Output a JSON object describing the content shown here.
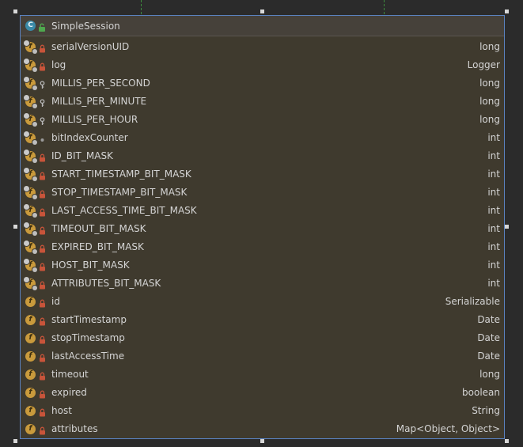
{
  "class": {
    "title": "SimpleSession",
    "kind_letter": "C",
    "kind_icon": "class-icon",
    "visibility_icon": "unlock-icon"
  },
  "fields": [
    {
      "name": "serialVersionUID",
      "type": "long",
      "visibility": "private",
      "static": true
    },
    {
      "name": "log",
      "type": "Logger",
      "visibility": "private",
      "static": true
    },
    {
      "name": "MILLIS_PER_SECOND",
      "type": "long",
      "visibility": "protected",
      "static": true
    },
    {
      "name": "MILLIS_PER_MINUTE",
      "type": "long",
      "visibility": "protected",
      "static": true
    },
    {
      "name": "MILLIS_PER_HOUR",
      "type": "long",
      "visibility": "protected",
      "static": true
    },
    {
      "name": "bitIndexCounter",
      "type": "int",
      "visibility": "package",
      "static": true
    },
    {
      "name": "ID_BIT_MASK",
      "type": "int",
      "visibility": "private",
      "static": true
    },
    {
      "name": "START_TIMESTAMP_BIT_MASK",
      "type": "int",
      "visibility": "private",
      "static": true
    },
    {
      "name": "STOP_TIMESTAMP_BIT_MASK",
      "type": "int",
      "visibility": "private",
      "static": true
    },
    {
      "name": "LAST_ACCESS_TIME_BIT_MASK",
      "type": "int",
      "visibility": "private",
      "static": true
    },
    {
      "name": "TIMEOUT_BIT_MASK",
      "type": "int",
      "visibility": "private",
      "static": true
    },
    {
      "name": "EXPIRED_BIT_MASK",
      "type": "int",
      "visibility": "private",
      "static": true
    },
    {
      "name": "HOST_BIT_MASK",
      "type": "int",
      "visibility": "private",
      "static": true
    },
    {
      "name": "ATTRIBUTES_BIT_MASK",
      "type": "int",
      "visibility": "private",
      "static": true
    },
    {
      "name": "id",
      "type": "Serializable",
      "visibility": "private",
      "static": false
    },
    {
      "name": "startTimestamp",
      "type": "Date",
      "visibility": "private",
      "static": false
    },
    {
      "name": "stopTimestamp",
      "type": "Date",
      "visibility": "private",
      "static": false
    },
    {
      "name": "lastAccessTime",
      "type": "Date",
      "visibility": "private",
      "static": false
    },
    {
      "name": "timeout",
      "type": "long",
      "visibility": "private",
      "static": false
    },
    {
      "name": "expired",
      "type": "boolean",
      "visibility": "private",
      "static": false
    },
    {
      "name": "host",
      "type": "String",
      "visibility": "private",
      "static": false
    },
    {
      "name": "attributes",
      "type": "Map<Object, Object>",
      "visibility": "private",
      "static": false
    }
  ],
  "field_icon_letter": "f",
  "colors": {
    "node_background": "#3f3a2e",
    "selection_border": "#5a82c0",
    "field_icon": "#c99a3c",
    "class_icon": "#3a8aa8",
    "private_lock": "#c8543a",
    "protected_key": "#b8b8b8",
    "package_dot": "#9a9a9a"
  }
}
